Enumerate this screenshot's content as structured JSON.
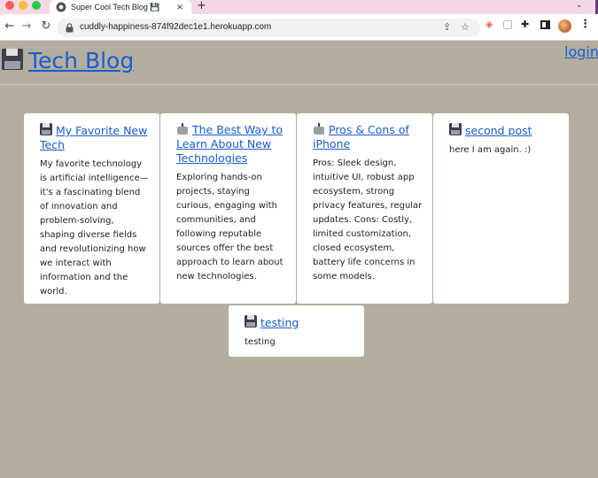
{
  "browser": {
    "tab_title": "Super Cool Tech Blog 💾",
    "tab_close": "×",
    "new_tab": "+",
    "url": "cuddly-happiness-874f92dec1e1.herokuapp.com"
  },
  "site": {
    "title": "Tech Blog",
    "login_label": "login"
  },
  "posts": [
    {
      "icon": "floppy-disk-icon",
      "title": "My Favorite New Tech",
      "body": "My favorite technology is artificial intelligence—it's a fascinating blend of innovation and problem-solving, shaping diverse fields and revolutionizing how we interact with information and the world."
    },
    {
      "icon": "robot-icon",
      "title": "The Best Way to Learn About New Technologies",
      "body": "Exploring hands-on projects, staying curious, engaging with communities, and following reputable sources offer the best approach to learn about new technologies."
    },
    {
      "icon": "robot-icon",
      "title": "Pros & Cons of iPhone",
      "body": "Pros: Sleek design, intuitive UI, robust app ecosystem, strong privacy features, regular updates. Cons: Costly, limited customization, closed ecosystem, battery life concerns in some models."
    },
    {
      "icon": "floppy-disk-icon",
      "title": "second post",
      "body": "here I am again. :)"
    },
    {
      "icon": "floppy-disk-icon",
      "title": "testing",
      "body": "testing"
    }
  ]
}
